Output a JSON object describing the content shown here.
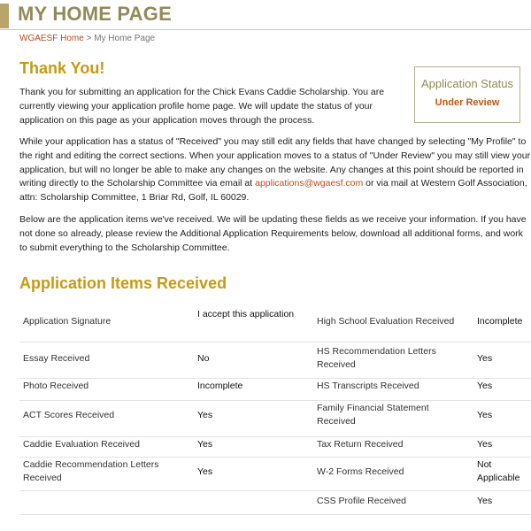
{
  "header": {
    "title": "MY HOME PAGE"
  },
  "breadcrumb": {
    "home_link": "WGAESF Home",
    "separator": " > ",
    "current": "My Home Page"
  },
  "thank_you": {
    "heading": "Thank You!"
  },
  "paragraph1": "Thank you for submitting an application for the Chick Evans Caddie Scholarship. You are currently viewing your application profile home page. We will update the status of your application on this page as your application moves through the process.",
  "paragraph2": {
    "text_before_link": "While your application has a status of \"Received\" you may still edit any fields that have changed by selecting \"My Profile\" to the right and editing the correct sections. When your application moves to a status of \"Under Review\" you may still view your application, but will no longer be able to make any changes on the website. Any changes at this point should be reported in writing directly to the Scholarship Committee via email at ",
    "email_link": "applications@wgaesf.com",
    "text_after_link": " or via mail at Western Golf Association, attn: Scholarship Committee, 1 Briar Rd, Golf, IL 60029."
  },
  "paragraph3": "Below are the application items we've received. We will be updating these fields as we receive your information. If you have not done so already, please review the Additional Application Requirements below, download all additional forms, and work to submit everything to the Scholarship Committee.",
  "status": {
    "label": "Application Status",
    "value": "Under Review"
  },
  "items_section": {
    "title": "Application Items Received"
  },
  "items": {
    "rows": [
      {
        "left_label": "Application Signature",
        "left_value": "I accept this application",
        "right_label": "High School Evaluation Received",
        "right_value": "Incomplete"
      },
      {
        "left_label": "Essay Received",
        "left_value": "No",
        "right_label": "HS Recommendation Letters Received",
        "right_value": "Yes"
      },
      {
        "left_label": "Photo Received",
        "left_value": "Incomplete",
        "right_label": "HS Transcripts Received",
        "right_value": "Yes"
      },
      {
        "left_label": "ACT Scores Received",
        "left_value": "Yes",
        "right_label": "Family Financial Statement Received",
        "right_value": "Yes"
      },
      {
        "left_label": "Caddie Evaluation Received",
        "left_value": "Yes",
        "right_label": "Tax Return Received",
        "right_value": "Yes"
      },
      {
        "left_label": "Caddie Recommendation Letters Received",
        "left_value": "Yes",
        "right_label": "W-2 Forms Received",
        "right_value": "Not Applicable"
      },
      {
        "left_label": "",
        "left_value": "",
        "right_label": "CSS Profile Received",
        "right_value": "Yes"
      }
    ]
  },
  "colors": {
    "heading_gold": "#c89a12",
    "link_orange": "#c04a1c",
    "status_value": "#c15712",
    "banner_olive": "#948a59"
  }
}
